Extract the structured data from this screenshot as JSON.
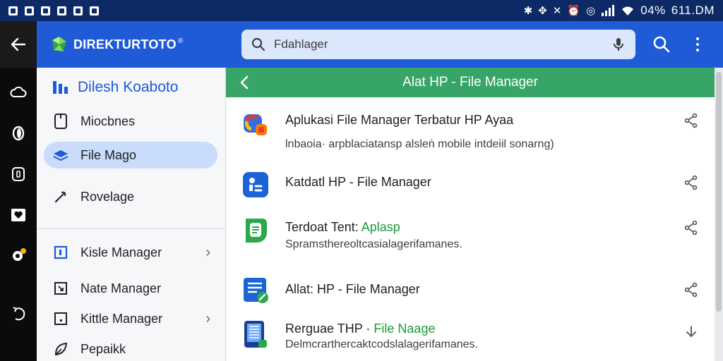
{
  "status_bar": {
    "battery": "04%",
    "time": "611.DM",
    "left_icons": [
      "notification-icon",
      "notification-icon",
      "notification-icon",
      "notification-icon",
      "notification-icon",
      "notification-icon"
    ],
    "right_icons": [
      "bluetooth-icon",
      "nfc-icon",
      "mute-icon",
      "alarm-icon",
      "alarm-icon",
      "signal-icon",
      "wifi-icon"
    ]
  },
  "app_bar": {
    "brand": "DIREKTURTOTO",
    "brand_mark": "®",
    "search": {
      "value": "Fdahlager",
      "icon": "search-icon",
      "mic": "mic-icon"
    },
    "actions": [
      "search-icon",
      "more-vert-icon"
    ]
  },
  "drawer": {
    "title": "Dilesh Koaboto",
    "items": [
      {
        "label": "Miocbnes",
        "icon": "phone-icon"
      },
      {
        "label": "File Mago",
        "icon": "folder-icon",
        "active": true
      },
      {
        "label": "Rovelage",
        "icon": "pen-icon"
      },
      {
        "label": "Kisle Manager",
        "icon": "square-icon",
        "chevron": "›"
      },
      {
        "label": "Nate Manager",
        "icon": "square-arrow-icon"
      },
      {
        "label": "Kittle Manager",
        "icon": "square-dot-icon",
        "chevron": "›"
      },
      {
        "label": "Pepaikk",
        "icon": "leaf-icon"
      }
    ]
  },
  "panel": {
    "header": "Alat HP - File Manager",
    "rows": [
      {
        "title": "Aplukasi File Manager Terbatur HP Ayaa",
        "subtitle": "lnbaoia· arpblaciatansp alsleṅ mobile intdeiil sonarng)",
        "icon": "google-app-icon",
        "action": "share-icon"
      },
      {
        "title": "Katdatl HP - File Manager",
        "subtitle": "",
        "icon": "files-app-icon",
        "action": "share-icon"
      },
      {
        "title_prefix": "Terdoat Tent:",
        "title_accent": "Aplasp",
        "subtitle": "Spramsthereoltcasialagerifamanes.",
        "icon": "document-app-icon",
        "action": "share-icon"
      },
      {
        "title": "Allat: HP - File Manager",
        "subtitle": "",
        "icon": "doc-edit-icon",
        "action": "share-icon"
      },
      {
        "title_prefix": "Rerguae THP ·",
        "title_accent": "File Naage",
        "subtitle": "Delmcrarthercaktcodslalagerifamanes.",
        "icon": "phone-app-icon",
        "action": "download-icon"
      }
    ]
  },
  "colors": {
    "status_bar": "#0d2a66",
    "app_bar": "#1f5bd6",
    "panel_header": "#37a567",
    "drawer_active": "#c9dcfb",
    "accent_text": "#1e9a3a"
  }
}
